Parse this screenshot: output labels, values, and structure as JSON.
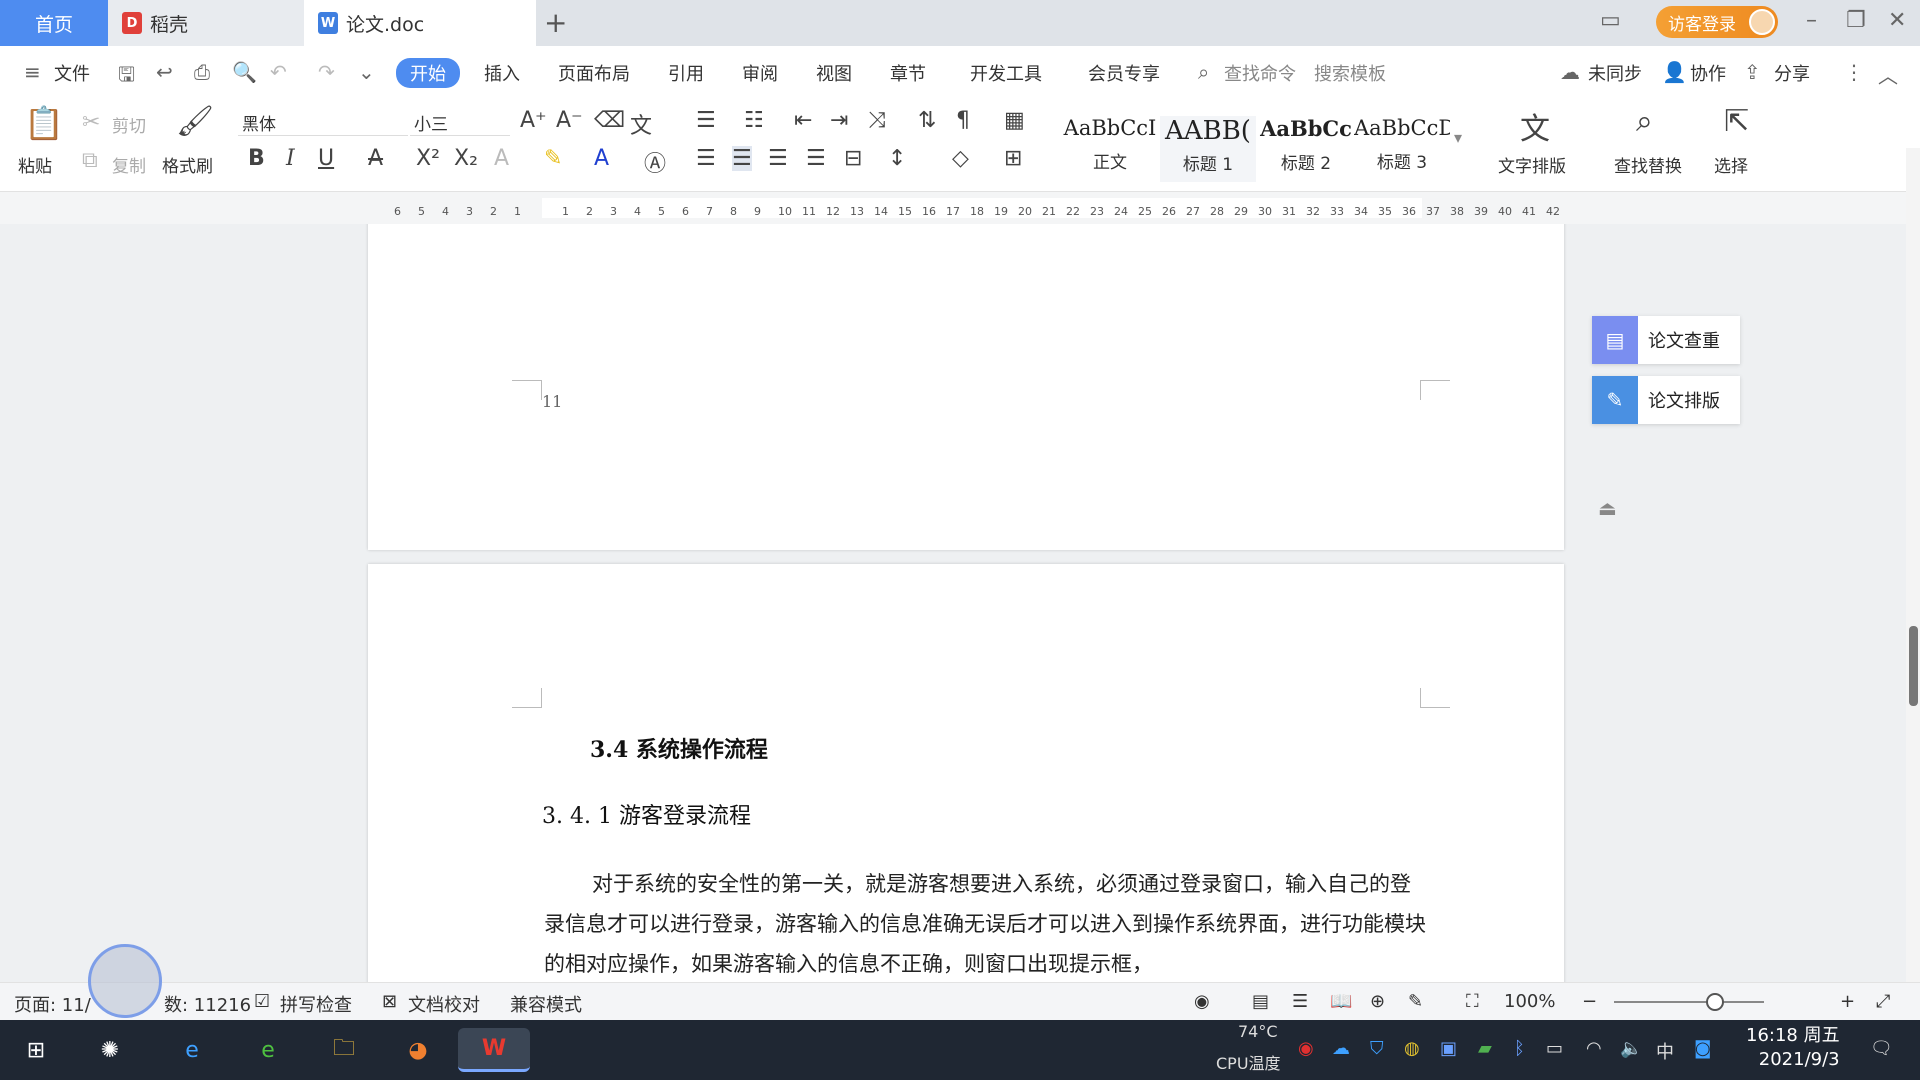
{
  "tabs": {
    "home": "首页",
    "daoke": "稻壳",
    "doc": "论文.doc"
  },
  "header": {
    "login": "访客登录"
  },
  "menu": {
    "file": "文件",
    "items": [
      "开始",
      "插入",
      "页面布局",
      "引用",
      "审阅",
      "视图",
      "章节",
      "开发工具",
      "会员专享"
    ],
    "search_cmd": "查找命令",
    "search_tpl": "搜索模板",
    "sync": "未同步",
    "collab": "协作",
    "share": "分享"
  },
  "ribbon": {
    "paste": "粘贴",
    "cut": "剪切",
    "copy": "复制",
    "format_painter": "格式刷",
    "font_name": "黑体",
    "font_size": "小三",
    "styles": [
      {
        "preview": "AaBbCcI",
        "label": "正文"
      },
      {
        "preview": "AABB(",
        "label": "标题 1"
      },
      {
        "preview": "AaBbCc",
        "label": "标题 2"
      },
      {
        "preview": "AaBbCcDc",
        "label": "标题 3"
      }
    ],
    "text_layout": "文字排版",
    "find_replace": "查找替换",
    "select": "选择"
  },
  "ruler": {
    "left": [
      "6",
      "5",
      "4",
      "3",
      "2",
      "1"
    ],
    "right": [
      "1",
      "2",
      "3",
      "4",
      "5",
      "6",
      "7",
      "8",
      "9",
      "10",
      "11",
      "12",
      "13",
      "14",
      "15",
      "16",
      "17",
      "18",
      "19",
      "20",
      "21",
      "22",
      "23",
      "24",
      "25",
      "26",
      "27",
      "28",
      "29",
      "30",
      "31",
      "32",
      "33",
      "34",
      "35",
      "36",
      "37",
      "38",
      "39",
      "40",
      "41",
      "42"
    ]
  },
  "document": {
    "page_number": "11",
    "heading2": "3.4 系统操作流程",
    "heading3": "3. 4. 1 游客登录流程",
    "paragraph": "对于系统的安全性的第一关，就是游客想要进入系统，必须通过登录窗口，输入自己的登录信息才可以进行登录，游客输入的信息准确无误后才可以进入到操作系统界面，进行功能模块的相对应操作，如果游客输入的信息不正确，则窗口出现提示框，"
  },
  "side_panel": {
    "check": "论文查重",
    "layout": "论文排版"
  },
  "status": {
    "page": "页面: 11/",
    "words": "数: 11216",
    "spell": "拼写检查",
    "proof": "文档校对",
    "compat": "兼容模式",
    "zoom": "100%"
  },
  "taskbar": {
    "temp": "74°C",
    "cpu": "CPU温度",
    "ime": "中",
    "time": "16:18 周五",
    "date": "2021/9/3"
  },
  "colors": {
    "accent": "#4e8cf0",
    "login": "#f08f24",
    "wps_red": "#d9342b",
    "side_icon1": "#7a8ef0",
    "side_icon2": "#4a90e2"
  }
}
